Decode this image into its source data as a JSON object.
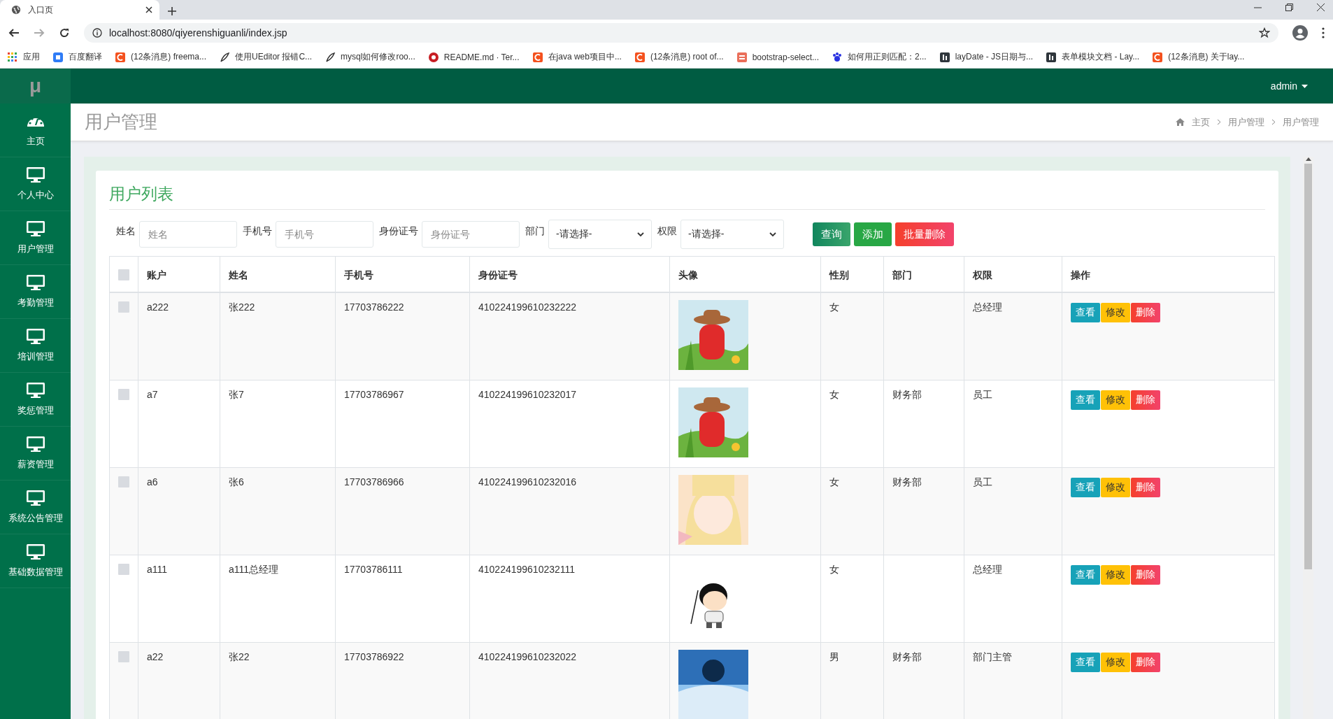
{
  "browser": {
    "tab_title": "入口页",
    "url": "localhost:8080/qiyerenshiguanli/index.jsp",
    "bookmarks": [
      {
        "kind": "apps",
        "label": "应用"
      },
      {
        "kind": "translate",
        "label": "百度翻译"
      },
      {
        "kind": "csdn",
        "label": "(12条消息) freema..."
      },
      {
        "kind": "feather",
        "label": "使用UEditor 报错C..."
      },
      {
        "kind": "feather",
        "label": "mysql如何修改roo..."
      },
      {
        "kind": "gitee",
        "label": "README.md · Ter..."
      },
      {
        "kind": "csdn",
        "label": "在java web项目中..."
      },
      {
        "kind": "csdn",
        "label": "(12条消息) root of..."
      },
      {
        "kind": "jianshu",
        "label": "bootstrap-select..."
      },
      {
        "kind": "baidu",
        "label": "如何用正则匹配：2..."
      },
      {
        "kind": "lay",
        "label": "layDate - JS日期与..."
      },
      {
        "kind": "lay",
        "label": "表单模块文档 - Lay..."
      },
      {
        "kind": "csdn",
        "label": "(12条消息) 关于lay..."
      }
    ]
  },
  "header": {
    "logo": "μ",
    "user": "admin"
  },
  "sidebar": {
    "items": [
      {
        "kind": "dashboard",
        "label": "主页"
      },
      {
        "kind": "monitor",
        "label": "个人中心"
      },
      {
        "kind": "monitor",
        "label": "用户管理"
      },
      {
        "kind": "monitor",
        "label": "考勤管理"
      },
      {
        "kind": "monitor",
        "label": "培训管理"
      },
      {
        "kind": "monitor",
        "label": "奖惩管理"
      },
      {
        "kind": "monitor",
        "label": "薪资管理"
      },
      {
        "kind": "monitor",
        "label": "系统公告管理"
      },
      {
        "kind": "monitor",
        "label": "基础数据管理"
      }
    ]
  },
  "page": {
    "title": "用户管理",
    "breadcrumb": [
      "主页",
      "用户管理",
      "用户管理"
    ]
  },
  "card": {
    "title": "用户列表",
    "filters": [
      {
        "kind": "text",
        "label": "姓名",
        "placeholder": "姓名"
      },
      {
        "kind": "text",
        "label": "手机号",
        "placeholder": "手机号"
      },
      {
        "kind": "text",
        "label": "身份证号",
        "placeholder": "身份证号"
      },
      {
        "kind": "select",
        "label": "部门",
        "value": "-请选择-"
      },
      {
        "kind": "select",
        "label": "权限",
        "value": "-请选择-"
      }
    ],
    "buttons": [
      {
        "kind": "search",
        "label": "查询"
      },
      {
        "kind": "add",
        "label": "添加"
      },
      {
        "kind": "delete",
        "label": "批量删除"
      }
    ],
    "table": {
      "select_all": {
        "checked": false
      },
      "columns": [
        "账户",
        "姓名",
        "手机号",
        "身份证号",
        "头像",
        "性别",
        "部门",
        "权限",
        "操作"
      ],
      "rows": [
        {
          "checked": false,
          "account": "a222",
          "name": "张222",
          "phone": "17703786222",
          "id_number": "410224199610232222",
          "gender": "女",
          "role": "总经理",
          "actions": [
            {
              "kind": "view",
              "label": "查看"
            },
            {
              "kind": "edit",
              "label": "修改"
            },
            {
              "kind": "delete",
              "label": "删除"
            }
          ]
        },
        {
          "checked": false,
          "account": "a7",
          "name": "张7",
          "phone": "17703786967",
          "id_number": "410224199610232017",
          "gender": "女",
          "department": "财务部",
          "role": "员工",
          "actions": [
            {
              "kind": "view",
              "label": "查看"
            },
            {
              "kind": "edit",
              "label": "修改"
            },
            {
              "kind": "delete",
              "label": "删除"
            }
          ]
        },
        {
          "checked": false,
          "account": "a6",
          "name": "张6",
          "phone": "17703786966",
          "id_number": "410224199610232016",
          "gender": "女",
          "department": "财务部",
          "role": "员工",
          "actions": [
            {
              "kind": "view",
              "label": "查看"
            },
            {
              "kind": "edit",
              "label": "修改"
            },
            {
              "kind": "delete",
              "label": "删除"
            }
          ]
        },
        {
          "checked": false,
          "account": "a111",
          "name": "a111总经理",
          "phone": "17703786111",
          "id_number": "410224199610232111",
          "gender": "女",
          "role": "总经理",
          "actions": [
            {
              "kind": "view",
              "label": "查看"
            },
            {
              "kind": "edit",
              "label": "修改"
            },
            {
              "kind": "delete",
              "label": "删除"
            }
          ]
        },
        {
          "checked": false,
          "account": "a22",
          "name": "张22",
          "phone": "17703786922",
          "id_number": "410224199610232022",
          "gender": "男",
          "department": "财务部",
          "role": "部门主管",
          "actions": [
            {
              "kind": "view",
              "label": "查看"
            },
            {
              "kind": "edit",
              "label": "修改"
            },
            {
              "kind": "delete",
              "label": "删除"
            }
          ]
        }
      ]
    }
  }
}
